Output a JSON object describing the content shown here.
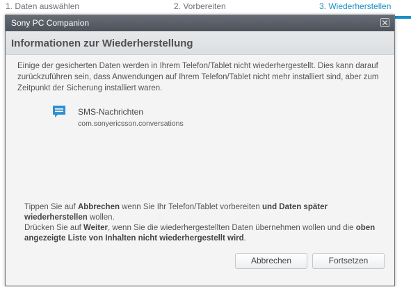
{
  "wizard": {
    "steps": [
      "1. Daten auswählen",
      "2. Vorbereiten",
      "3. Wiederherstellen"
    ],
    "active_color": "#1c8fc4"
  },
  "dialog": {
    "title": "Sony PC Companion",
    "close_icon": "close-icon",
    "heading": "Informationen zur Wiederherstellung",
    "intro": "Einige der gesicherten Daten werden in Ihrem Telefon/Tablet nicht wiederhergestellt. Dies kann darauf zurückzuführen sein, dass Anwendungen auf Ihrem Telefon/Tablet nicht mehr installiert sind, aber zum Zeitpunkt der Sicherung installiert waren.",
    "items": [
      {
        "icon": "sms-icon",
        "title": "SMS-Nachrichten",
        "package": "com.sonyericsson.conversations"
      }
    ],
    "footer": {
      "p1_a": "Tippen Sie auf ",
      "p1_b": "Abbrechen",
      "p1_c": " wenn Sie Ihr Telefon/Tablet vorbereiten ",
      "p1_d": "und Daten später wiederherstellen",
      "p1_e": " wollen.",
      "p2_a": "Drücken Sie auf ",
      "p2_b": "Weiter",
      "p2_c": ", wenn Sie die wiederhergestellten Daten übernehmen wollen und die ",
      "p2_d": "oben angezeigte Liste von Inhalten nicht wiederhergestellt wird",
      "p2_e": "."
    },
    "buttons": {
      "cancel": "Abbrechen",
      "continue": "Fortsetzen"
    }
  }
}
